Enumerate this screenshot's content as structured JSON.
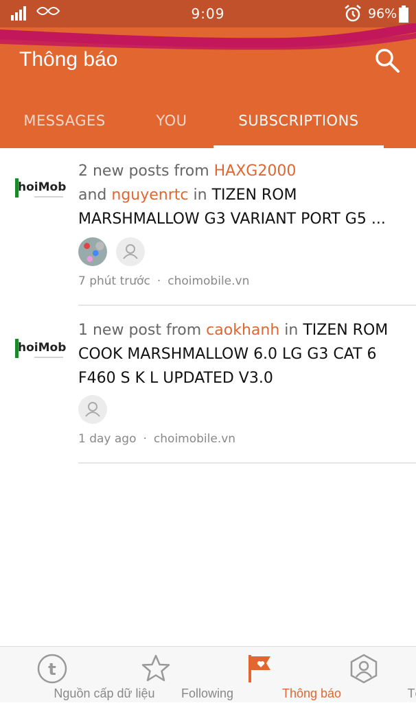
{
  "status_bar": {
    "time": "9:09",
    "battery": "96%"
  },
  "header": {
    "title": "Thông báo"
  },
  "tabs": [
    {
      "label": "MESSAGES",
      "active": false
    },
    {
      "label": "YOU",
      "active": false
    },
    {
      "label": "SUBSCRIPTIONS",
      "active": true
    }
  ],
  "notifications": [
    {
      "prefix": "2 new posts from",
      "user1": "HAXG2000",
      "and": "and",
      "user2": "nguyenrtc",
      "in": "in",
      "thread": "TIZEN ROM MARSHMALLOW G3 VARIANT PORT G5 ...",
      "time": "7 phút trước",
      "dot": "·",
      "site": "choimobile.vn",
      "logo_text": "hoiMobil"
    },
    {
      "prefix": "1 new post from",
      "user1": "caokhanh",
      "in": "in",
      "thread": "TIZEN ROM COOK MARSHMALLOW 6.0 LG G3 CAT 6 F460 S K L UPDATED V3.0",
      "time": "1 day ago",
      "dot": "·",
      "site": "choimobile.vn",
      "logo_text": "hoiMobil"
    }
  ],
  "bottom_nav": [
    {
      "label": "Nguồn cấp dữ liệu",
      "icon": "tumblr-t-icon"
    },
    {
      "label": "Following",
      "icon": "star-icon"
    },
    {
      "label": "Thông báo",
      "icon": "flag-heart-icon",
      "active": true
    },
    {
      "label": "Tôi",
      "icon": "user-icon"
    }
  ],
  "colors": {
    "accent": "#e1662f",
    "status_bar": "#c1512a",
    "scribble": "#c2185b"
  }
}
